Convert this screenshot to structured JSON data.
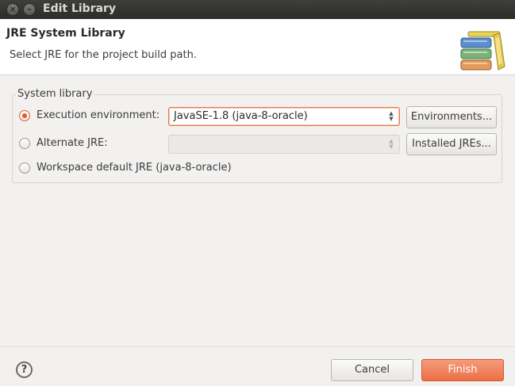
{
  "window": {
    "title": "Edit Library",
    "controls": [
      "close-icon",
      "minimize-icon"
    ]
  },
  "header": {
    "title": "JRE System Library",
    "description": "Select JRE for the project build path.",
    "icon": "books-library-icon"
  },
  "system_library": {
    "legend": "System library",
    "options": [
      {
        "label": "Execution environment:",
        "selected": true,
        "combo_value": "JavaSE-1.8 (java-8-oracle)",
        "combo_enabled": true,
        "button": "Environments..."
      },
      {
        "label": "Alternate JRE:",
        "selected": false,
        "combo_value": "",
        "combo_enabled": false,
        "button": "Installed JREs..."
      },
      {
        "label": "Workspace default JRE (java-8-oracle)",
        "selected": false
      }
    ]
  },
  "footer": {
    "help_icon": "help-icon",
    "help_glyph": "?",
    "cancel": "Cancel",
    "finish": "Finish"
  },
  "colors": {
    "accent": "#e05a26",
    "primary_button": "#ec6f45"
  }
}
